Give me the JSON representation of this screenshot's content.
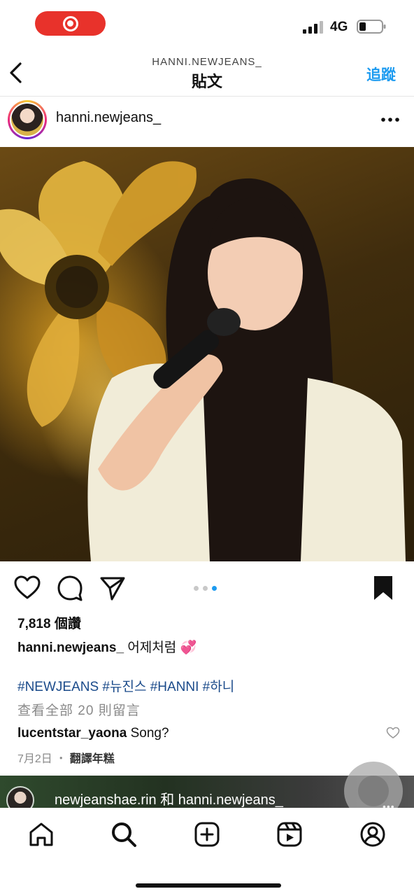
{
  "status_bar": {
    "network": "4G"
  },
  "header": {
    "username": "HANNI.NEWJEANS_",
    "title": "貼文",
    "follow_label": "追蹤"
  },
  "post": {
    "username": "hanni.newjeans_",
    "carousel": {
      "total": 3,
      "active_index": 2
    },
    "likes": "7,818 個讚",
    "caption": {
      "username": "hanni.newjeans_",
      "text": "어제처럼 💞"
    },
    "hashtags": "#NEWJEANS #뉴진스 #HANNI #하니",
    "view_comments": "查看全部 20 則留言",
    "top_comment": {
      "username": "lucentstar_yaona",
      "text": "Song?"
    },
    "date": "7月2日",
    "separator": "・",
    "translate_label": "翻譯年糕"
  },
  "next_post": {
    "usernames": "newjeanshae.rin 和 hanni.newjeans_"
  },
  "icons": [
    "record-icon",
    "signal-icon",
    "battery-icon",
    "back-icon",
    "more-icon",
    "heart-icon",
    "comment-icon",
    "share-icon",
    "bookmark-icon",
    "home-icon",
    "search-icon",
    "create-icon",
    "reels-icon",
    "profile-icon"
  ],
  "colors": {
    "accent": "#1d9bf0",
    "record": "#e8322b",
    "hashtag": "#1a4a8a"
  }
}
